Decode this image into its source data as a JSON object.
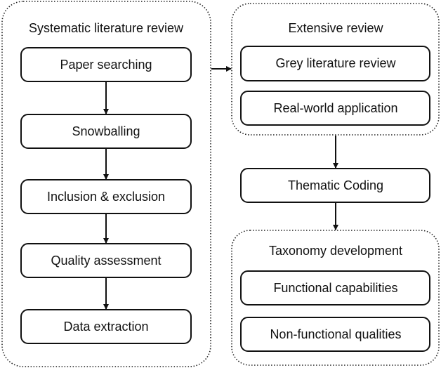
{
  "groups": {
    "systematic": {
      "title": "Systematic literature review",
      "steps": [
        "Paper searching",
        "Snowballing",
        "Inclusion & exclusion",
        "Quality assessment",
        "Data extraction"
      ]
    },
    "extensive": {
      "title": "Extensive review",
      "steps": [
        "Grey literature review",
        "Real-world application"
      ]
    },
    "thematic": "Thematic Coding",
    "taxonomy": {
      "title": "Taxonomy development",
      "steps": [
        "Functional capabilities",
        "Non-functional qualities"
      ]
    }
  }
}
